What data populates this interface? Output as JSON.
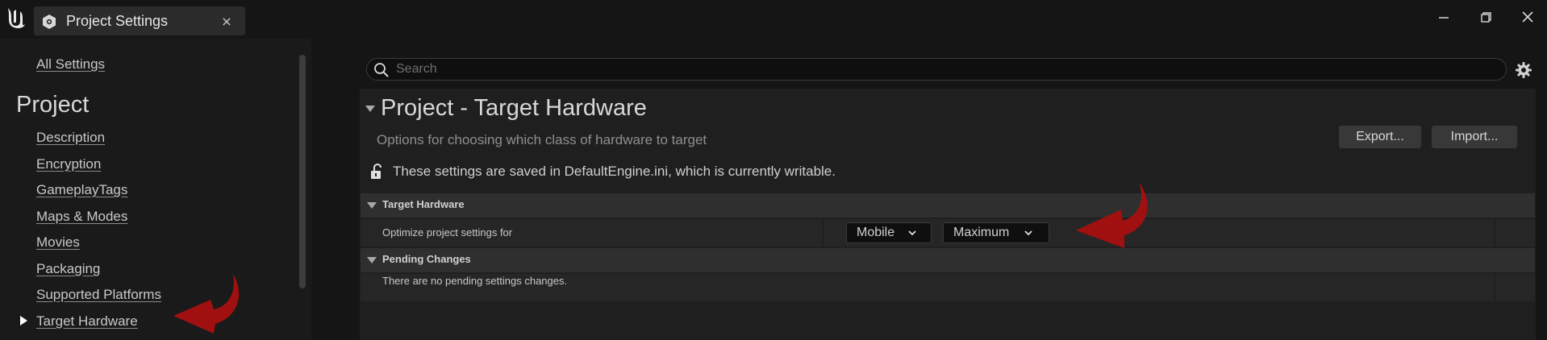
{
  "window": {
    "tab_title": "Project Settings",
    "tab_close": "×"
  },
  "sidebar": {
    "all_settings": "All Settings",
    "section_title": "Project",
    "items": [
      {
        "label": "Description"
      },
      {
        "label": "Encryption"
      },
      {
        "label": "GameplayTags"
      },
      {
        "label": "Maps & Modes"
      },
      {
        "label": "Movies"
      },
      {
        "label": "Packaging"
      },
      {
        "label": "Supported Platforms"
      },
      {
        "label": "Target Hardware",
        "selected": true
      }
    ]
  },
  "search": {
    "placeholder": "Search",
    "value": ""
  },
  "page": {
    "title": "Project - Target Hardware",
    "subtitle": "Options for choosing which class of hardware to target",
    "export_label": "Export...",
    "import_label": "Import...",
    "saved_notice": "These settings are saved in DefaultEngine.ini, which is currently writable."
  },
  "target_hardware": {
    "header": "Target Hardware",
    "row_label": "Optimize project settings for",
    "platform_value": "Mobile",
    "quality_value": "Maximum"
  },
  "pending_changes": {
    "header": "Pending Changes",
    "message": "There are no pending settings changes."
  },
  "colors": {
    "annotation_arrow": "#a01010",
    "background": "#151515",
    "panel": "#1f1f1f"
  },
  "icons": [
    "unreal-logo-icon",
    "settings-tab-icon",
    "close-icon",
    "minimize-icon",
    "restore-icon",
    "window-close-icon",
    "search-icon",
    "gear-icon",
    "unlock-icon",
    "chevron-down-icon",
    "triangle-right-icon",
    "triangle-down-icon"
  ]
}
